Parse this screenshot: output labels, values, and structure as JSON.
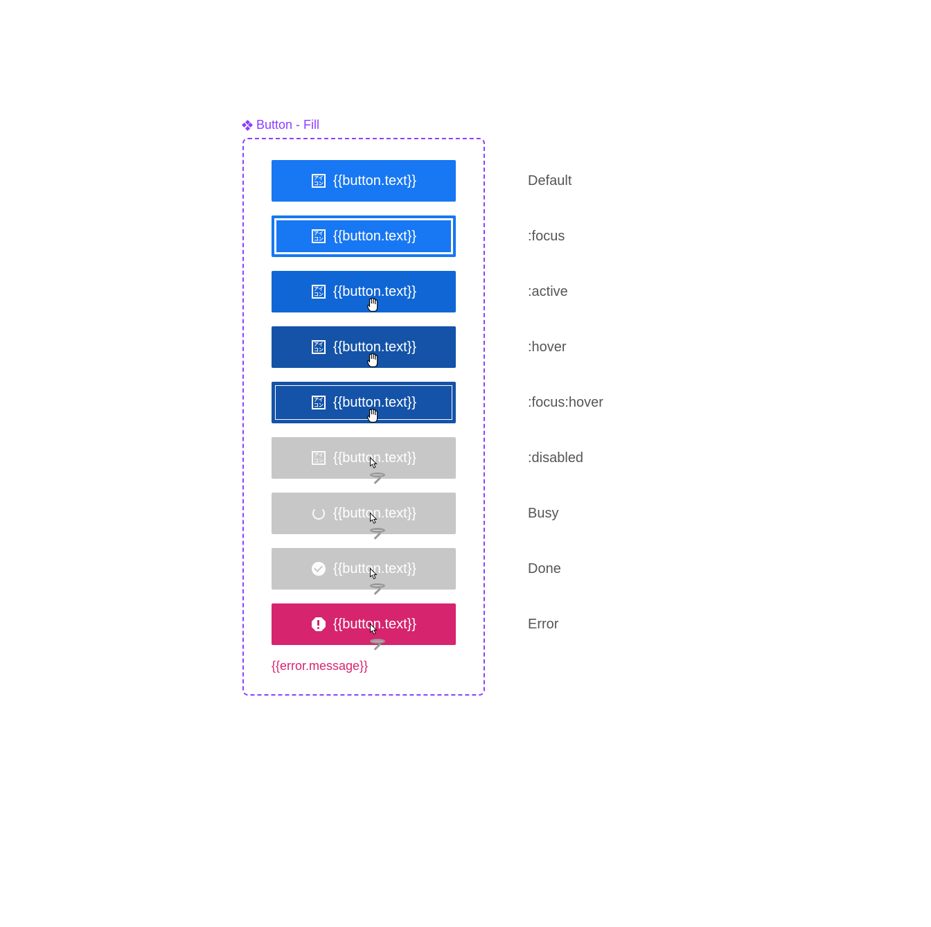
{
  "component": {
    "title": "Button - Fill"
  },
  "button_placeholder": "{{button.text}}",
  "icon_placeholder_text": "アイ\nコン",
  "states": [
    {
      "key": "default",
      "label": "Default",
      "btnClass": "btn-default",
      "icon": "placeholder",
      "cursor": null
    },
    {
      "key": "focus",
      "label": ":focus",
      "btnClass": "btn-focus",
      "icon": "placeholder",
      "cursor": null,
      "focusRing": true
    },
    {
      "key": "active",
      "label": ":active",
      "btnClass": "btn-active",
      "icon": "placeholder",
      "cursor": "pointer"
    },
    {
      "key": "hover",
      "label": ":hover",
      "btnClass": "btn-hover",
      "icon": "placeholder",
      "cursor": "pointer"
    },
    {
      "key": "focushover",
      "label": ":focus:hover",
      "btnClass": "btn-focushover",
      "icon": "placeholder",
      "cursor": "pointer",
      "focusRing": true
    },
    {
      "key": "disabled",
      "label": ":disabled",
      "btnClass": "btn-disabled",
      "icon": "placeholder-faded",
      "cursor": "not-allowed"
    },
    {
      "key": "busy",
      "label": "Busy",
      "btnClass": "btn-busy",
      "icon": "spin",
      "cursor": "not-allowed"
    },
    {
      "key": "done",
      "label": "Done",
      "btnClass": "btn-done",
      "icon": "check",
      "cursor": "not-allowed"
    },
    {
      "key": "error",
      "label": "Error",
      "btnClass": "btn-error",
      "icon": "alert",
      "cursor": "not-allowed"
    }
  ],
  "error_message": "{{error.message}}",
  "colors": {
    "primary": "#1877f2",
    "active": "#1166d6",
    "hover": "#1453a8",
    "disabled": "#c7c7c7",
    "error": "#d6246e",
    "accent": "#8b3fff"
  }
}
